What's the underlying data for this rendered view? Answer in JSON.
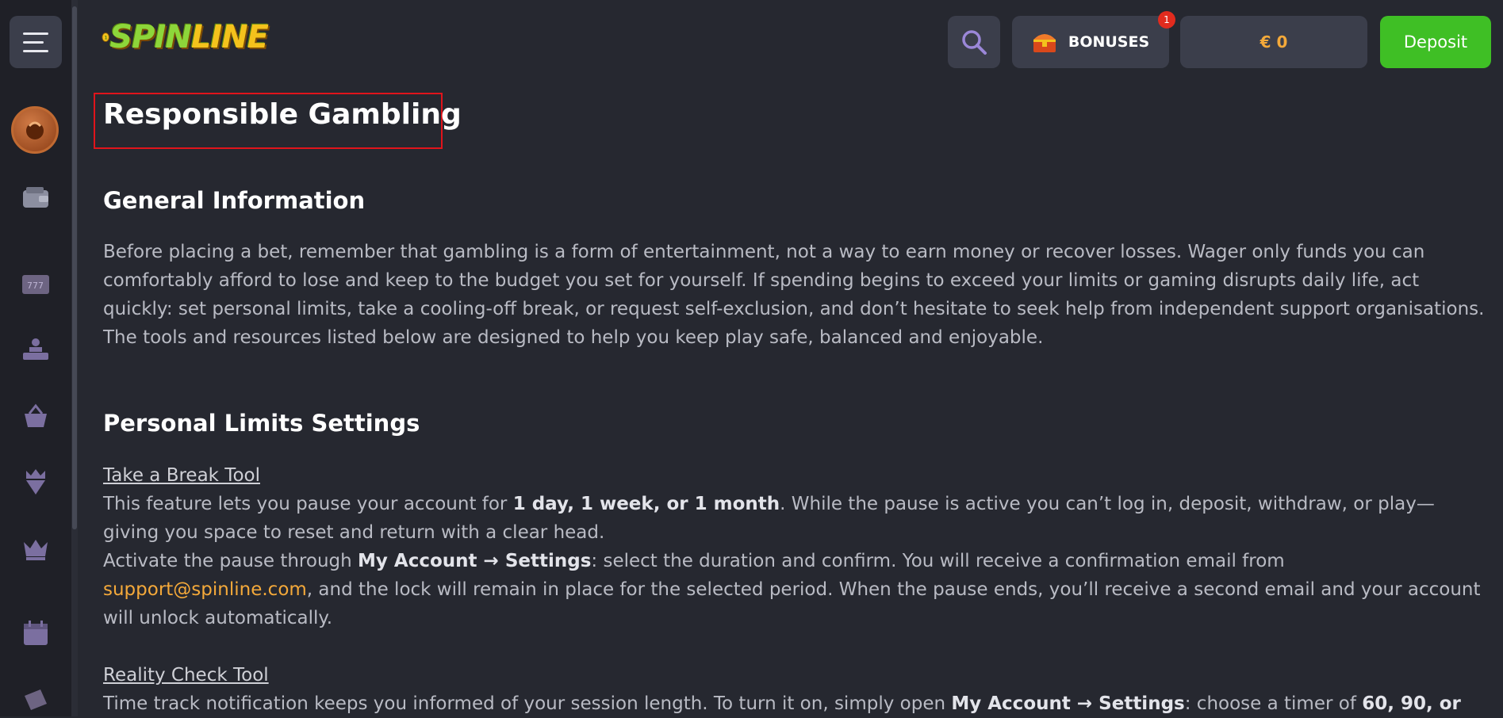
{
  "header": {
    "logo_text_a": "SPIN",
    "logo_text_b": "LINE",
    "bonuses_label": "BONUSES",
    "bonuses_badge": "1",
    "balance": "€ 0",
    "deposit_label": "Deposit"
  },
  "sidebar": {
    "icons": [
      "menu-icon",
      "avatar-icon",
      "wallet-icon",
      "slot-777-icon",
      "live-dealer-icon",
      "basket-icon",
      "gem-crown-icon",
      "crown-icon",
      "calendar-icon",
      "ticket-icon"
    ]
  },
  "page": {
    "title": "Responsible Gambling",
    "general_heading": "General Information",
    "general_p1": "Before placing a bet, remember that gambling is a form of entertainment, not a way to earn money or recover losses. Wager only funds you can comfortably afford to lose and keep to the budget you set for yourself. If spending begins to exceed your limits or gaming disrupts daily life, act quickly: set personal limits, take a cooling-off break, or request self-exclusion, and don’t hesitate to seek help from independent support organisations.",
    "general_p2": "The tools and resources listed below are designed to help you keep play safe, balanced and enjoyable.",
    "limits_heading": "Personal Limits Settings",
    "break_link": "Take a Break Tool",
    "break_p1_a": "This feature lets you pause your account for ",
    "break_p1_b": "1 day, 1 week, or 1 month",
    "break_p1_c": ". While the pause is active you can’t log in, deposit, withdraw, or play—giving you space to reset and return with a clear head.",
    "break_p2_a": "Activate the pause through ",
    "break_p2_b": "My Account",
    "break_p2_c": " → ",
    "break_p2_d": "Settings",
    "break_p2_e": ": select the duration and confirm. You will receive a confirmation email from ",
    "break_email": "support@spinline.com",
    "break_p2_f": ", and the lock will remain in place for the selected period. When the pause ends, you’ll receive a second email and your account will unlock automatically.",
    "reality_link": "Reality Check Tool",
    "reality_p_a": "Time track notification keeps you informed of your session length. To turn it on, simply open ",
    "reality_p_b": "My Account",
    "reality_p_c": " → ",
    "reality_p_d": "Settings",
    "reality_p_e": ": choose a timer of ",
    "reality_p_f": "60, 90, or"
  },
  "colors": {
    "background": "#262830",
    "sidebar": "#1f2027",
    "button": "#3b3e4b",
    "deposit": "#3fbf25",
    "accent_orange": "#f4a93a",
    "highlight_border": "#e0141b"
  }
}
